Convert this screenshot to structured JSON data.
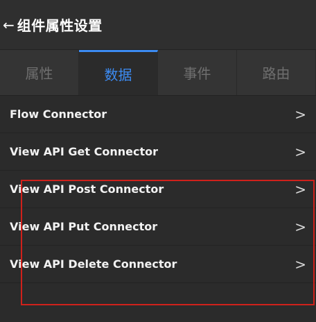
{
  "header": {
    "back_glyph": "←",
    "title": "组件属性设置"
  },
  "tabs": [
    {
      "label": "属性",
      "active": false
    },
    {
      "label": "数据",
      "active": true
    },
    {
      "label": "事件",
      "active": false
    },
    {
      "label": "路由",
      "active": false
    }
  ],
  "connectors": [
    {
      "label": "Flow Connector"
    },
    {
      "label": "View API Get Connector"
    },
    {
      "label": "View API Post Connector"
    },
    {
      "label": "View API Put Connector"
    },
    {
      "label": "View API Delete Connector"
    }
  ],
  "colors": {
    "accent": "#3c8bf2",
    "highlight": "#d0211b",
    "background": "#2b2b2b"
  },
  "icons": {
    "back": "arrow-left-icon",
    "row_chevron": "chevron-right-icon"
  }
}
